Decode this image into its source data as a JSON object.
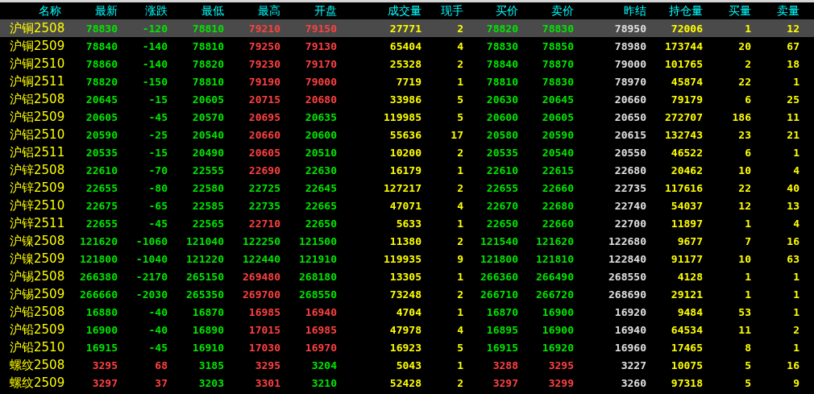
{
  "columns": [
    "名称",
    "最新",
    "涨跌",
    "最低",
    "最高",
    "开盘",
    "成交量",
    "现手",
    "买价",
    "卖价",
    "昨结",
    "持仓量",
    "买量",
    "卖量"
  ],
  "rows": [
    {
      "selected": true,
      "cells": [
        "沪铜2508",
        "78830",
        "-120",
        "78810",
        "79210",
        "79150",
        "27771",
        "2",
        "78820",
        "78830",
        "78950",
        "72006",
        "1",
        "12"
      ]
    },
    {
      "selected": false,
      "cells": [
        "沪铜2509",
        "78840",
        "-140",
        "78810",
        "79250",
        "79130",
        "65404",
        "4",
        "78830",
        "78850",
        "78980",
        "173744",
        "20",
        "67"
      ]
    },
    {
      "selected": false,
      "cells": [
        "沪铜2510",
        "78860",
        "-140",
        "78820",
        "79230",
        "79170",
        "25328",
        "2",
        "78840",
        "78870",
        "79000",
        "101765",
        "2",
        "18"
      ]
    },
    {
      "selected": false,
      "cells": [
        "沪铜2511",
        "78820",
        "-150",
        "78810",
        "79190",
        "79000",
        "7719",
        "1",
        "78810",
        "78830",
        "78970",
        "45874",
        "22",
        "1"
      ]
    },
    {
      "selected": false,
      "cells": [
        "沪铝2508",
        "20645",
        "-15",
        "20605",
        "20715",
        "20680",
        "33986",
        "5",
        "20630",
        "20645",
        "20660",
        "79179",
        "6",
        "25"
      ]
    },
    {
      "selected": false,
      "cells": [
        "沪铝2509",
        "20605",
        "-45",
        "20570",
        "20695",
        "20635",
        "119985",
        "5",
        "20600",
        "20605",
        "20650",
        "272707",
        "186",
        "11"
      ]
    },
    {
      "selected": false,
      "cells": [
        "沪铝2510",
        "20590",
        "-25",
        "20540",
        "20660",
        "20600",
        "55636",
        "17",
        "20580",
        "20590",
        "20615",
        "132743",
        "23",
        "21"
      ]
    },
    {
      "selected": false,
      "cells": [
        "沪铝2511",
        "20535",
        "-15",
        "20490",
        "20605",
        "20510",
        "10200",
        "2",
        "20535",
        "20540",
        "20550",
        "46522",
        "6",
        "1"
      ]
    },
    {
      "selected": false,
      "cells": [
        "沪锌2508",
        "22610",
        "-70",
        "22555",
        "22690",
        "22630",
        "16179",
        "1",
        "22610",
        "22615",
        "22680",
        "20462",
        "10",
        "4"
      ]
    },
    {
      "selected": false,
      "cells": [
        "沪锌2509",
        "22655",
        "-80",
        "22580",
        "22725",
        "22645",
        "127217",
        "2",
        "22655",
        "22660",
        "22735",
        "117616",
        "22",
        "40"
      ]
    },
    {
      "selected": false,
      "cells": [
        "沪锌2510",
        "22675",
        "-65",
        "22585",
        "22735",
        "22665",
        "47071",
        "4",
        "22670",
        "22680",
        "22740",
        "54037",
        "12",
        "13"
      ]
    },
    {
      "selected": false,
      "cells": [
        "沪锌2511",
        "22655",
        "-45",
        "22565",
        "22710",
        "22650",
        "5633",
        "1",
        "22650",
        "22660",
        "22700",
        "11897",
        "1",
        "4"
      ]
    },
    {
      "selected": false,
      "cells": [
        "沪镍2508",
        "121620",
        "-1060",
        "121040",
        "122250",
        "121500",
        "11380",
        "2",
        "121540",
        "121620",
        "122680",
        "9677",
        "7",
        "16"
      ]
    },
    {
      "selected": false,
      "cells": [
        "沪镍2509",
        "121800",
        "-1040",
        "121220",
        "122440",
        "121910",
        "119935",
        "9",
        "121800",
        "121810",
        "122840",
        "91177",
        "10",
        "63"
      ]
    },
    {
      "selected": false,
      "cells": [
        "沪锡2508",
        "266380",
        "-2170",
        "265150",
        "269480",
        "268180",
        "13305",
        "1",
        "266360",
        "266490",
        "268550",
        "4128",
        "1",
        "1"
      ]
    },
    {
      "selected": false,
      "cells": [
        "沪锡2509",
        "266660",
        "-2030",
        "265350",
        "269700",
        "268550",
        "73248",
        "2",
        "266710",
        "266720",
        "268690",
        "29121",
        "1",
        "1"
      ]
    },
    {
      "selected": false,
      "cells": [
        "沪铅2508",
        "16880",
        "-40",
        "16870",
        "16985",
        "16940",
        "4704",
        "1",
        "16870",
        "16900",
        "16920",
        "9484",
        "53",
        "1"
      ]
    },
    {
      "selected": false,
      "cells": [
        "沪铅2509",
        "16900",
        "-40",
        "16890",
        "17015",
        "16985",
        "47978",
        "4",
        "16895",
        "16900",
        "16940",
        "64534",
        "11",
        "2"
      ]
    },
    {
      "selected": false,
      "cells": [
        "沪铅2510",
        "16915",
        "-45",
        "16910",
        "17030",
        "16970",
        "16923",
        "5",
        "16915",
        "16920",
        "16960",
        "17465",
        "8",
        "1"
      ]
    },
    {
      "selected": false,
      "cells": [
        "螺纹2508",
        "3295",
        "68",
        "3185",
        "3295",
        "3204",
        "5043",
        "1",
        "3288",
        "3295",
        "3227",
        "10075",
        "5",
        "16"
      ]
    },
    {
      "selected": false,
      "cells": [
        "螺纹2509",
        "3297",
        "37",
        "3203",
        "3301",
        "3210",
        "52428",
        "2",
        "3297",
        "3299",
        "3260",
        "97318",
        "5",
        "9"
      ]
    }
  ]
}
